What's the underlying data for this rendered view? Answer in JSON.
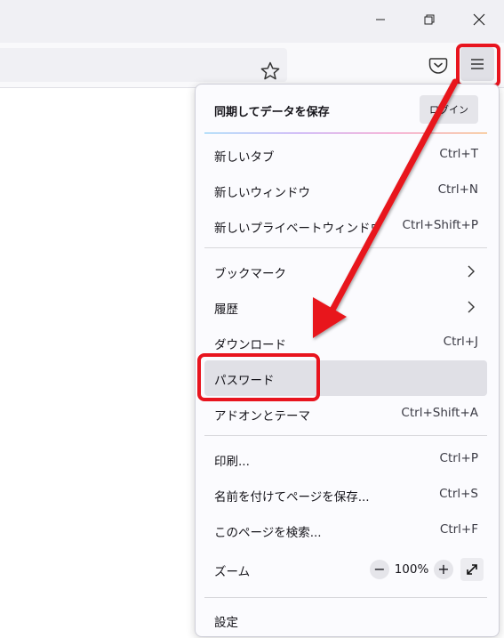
{
  "window_controls": {
    "minimize": "minimize-icon",
    "restore": "restore-icon",
    "close": "close-icon"
  },
  "toolbar": {
    "bookmark_icon": "star-icon",
    "pocket_icon": "pocket-icon",
    "menu_icon": "hamburger-menu-icon"
  },
  "menu": {
    "sync": {
      "label": "同期してデータを保存",
      "login": "ログイン"
    },
    "group1": [
      {
        "label": "新しいタブ",
        "shortcut": "Ctrl+T"
      },
      {
        "label": "新しいウィンドウ",
        "shortcut": "Ctrl+N"
      },
      {
        "label": "新しいプライベートウィンドウ",
        "shortcut": "Ctrl+Shift+P"
      }
    ],
    "group2": [
      {
        "label": "ブックマーク",
        "submenu": true
      },
      {
        "label": "履歴",
        "submenu": true
      },
      {
        "label": "ダウンロード",
        "shortcut": "Ctrl+J"
      },
      {
        "label": "パスワード",
        "shortcut": "",
        "highlighted": true
      },
      {
        "label": "アドオンとテーマ",
        "shortcut": "Ctrl+Shift+A"
      }
    ],
    "group3": [
      {
        "label": "印刷...",
        "shortcut": "Ctrl+P"
      },
      {
        "label": "名前を付けてページを保存...",
        "shortcut": "Ctrl+S"
      },
      {
        "label": "このページを検索...",
        "shortcut": "Ctrl+F"
      }
    ],
    "zoom": {
      "label": "ズーム",
      "minus": "−",
      "value": "100%",
      "plus": "+"
    },
    "settings": {
      "label": "設定"
    }
  },
  "annotation": {
    "color": "#e8141e"
  }
}
